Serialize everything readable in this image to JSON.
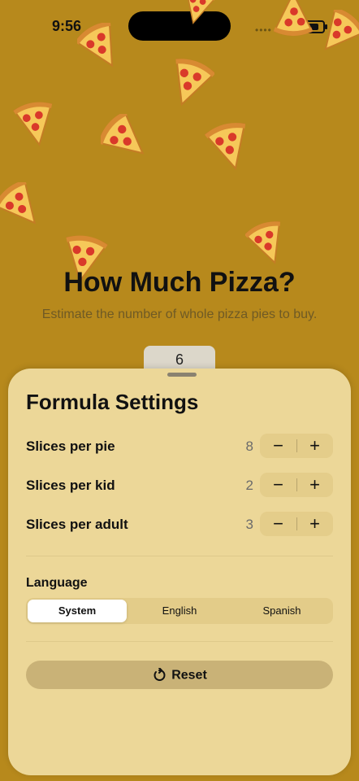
{
  "status": {
    "time": "9:56",
    "dots": "••••"
  },
  "hero": {
    "title": "How Much Pizza?",
    "subtitle": "Estimate the number of whole pizza pies to buy."
  },
  "result": {
    "count": "6"
  },
  "sheet": {
    "title": "Formula Settings",
    "rows": [
      {
        "label": "Slices per pie",
        "value": "8",
        "minus": "−",
        "plus": "+"
      },
      {
        "label": "Slices per kid",
        "value": "2",
        "minus": "−",
        "plus": "+"
      },
      {
        "label": "Slices per adult",
        "value": "3",
        "minus": "−",
        "plus": "+"
      }
    ],
    "language": {
      "label": "Language",
      "options": [
        "System",
        "English",
        "Spanish"
      ],
      "selected": "System"
    },
    "reset_label": "Reset"
  },
  "colors": {
    "background": "#b7891c",
    "sheet": "#ecd798",
    "pizza_crust": "#d89a3a",
    "pepperoni": "#d9392a"
  }
}
